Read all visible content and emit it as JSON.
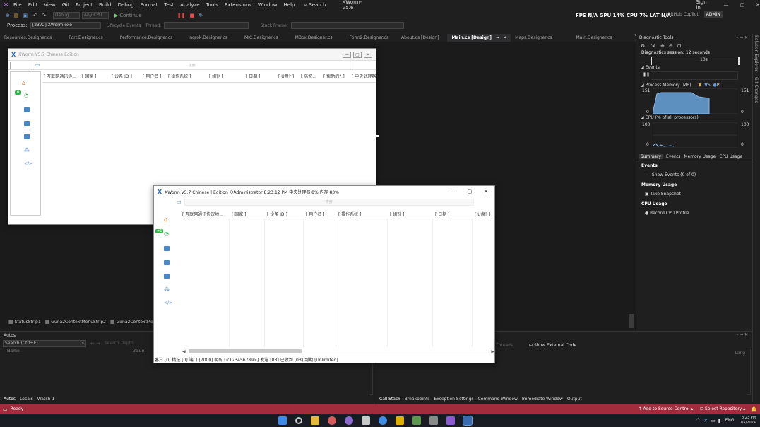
{
  "menubar": {
    "items": [
      "File",
      "Edit",
      "View",
      "Git",
      "Project",
      "Build",
      "Debug",
      "Format",
      "Test",
      "Analyze",
      "Tools",
      "Extensions",
      "Window",
      "Help"
    ],
    "search": "Search",
    "title": "XWorm-V5.6",
    "sign_in": "Sign in",
    "github": "GitHub Copilot",
    "admin": "ADMIN"
  },
  "toolbar": {
    "debug": "Debug",
    "cpu": "Any CPU",
    "continue": "Continue",
    "metrics": "FPS N/A GPU 14% CPU 7% LAT N/A"
  },
  "procbar": {
    "label": "Process:",
    "process": "[2372] XWorm.exe",
    "lifecycle": "Lifecycle Events",
    "thread": "Thread:",
    "stack": "Stack Frame:"
  },
  "tabs": [
    "Resources.Designer.cs",
    "Port.Designer.cs",
    "Performance.Designer.cs",
    "ngrok.Designer.cs",
    "MIC.Designer.cs",
    "MBox.Designer.cs",
    "Form2.Designer.cs",
    "About.cs [Design]",
    "Main.cs [Design]",
    "Maps.Designer.cs",
    "Main.Designer.cs"
  ],
  "designer": {
    "title": "XWorm V5.7 Chinese Edition",
    "search": "搜索",
    "columns": [
      "[ 互联网通讯协...",
      "[ 国家 ]",
      "[ 设备 ID ]",
      "[ 用户名 ]",
      "[ 操作系统 ]",
      "[ 组别 ]",
      "[ 日期 ]",
      "[ U盘? ]",
      "[ 防警...",
      "[ 帮助的? ]",
      "[ 中央处理器"
    ],
    "badge": "0",
    "components": [
      "StatusStrip1",
      "Guna2ContextMenuStrip2",
      "Guna2ContextMenuStr"
    ]
  },
  "app": {
    "title": "XWorm V5.7 Chinese | Edition @Administrator   8:23:12 PM   中央处理器 8%   内存 83%",
    "search": "搜索",
    "columns": [
      "[ 互联网通讯协议地...",
      "[ 国家 ]",
      "[ 设备 ID ]",
      "[ 用户名 ]",
      "[ 操作系统 ]",
      "[ 组别 ]",
      "[ 日期 ]",
      "[ U盘? ]"
    ],
    "badge": "+1",
    "status": "客户 [0]   精选 [0]   端口 [7000]   明码 [<123456789>]   发送 [0B]   已收到 [0B]   到期 [Unlimited]"
  },
  "diag": {
    "title": "Diagnostic Tools",
    "session": "Diagnostics session: 12 seconds",
    "time": "10s",
    "events": "Events",
    "memory": "Process Memory (MB)",
    "mem_legend": "S",
    "mem_legend2": "P..",
    "mem_max": "151",
    "mem_min": "0",
    "cpu": "CPU (% of all processors)",
    "cpu_max": "100",
    "cpu_min": "0",
    "tabs": [
      "Summary",
      "Events",
      "Memory Usage",
      "CPU Usage"
    ],
    "sec_events": "Events",
    "show_events": "Show Events (0 of 0)",
    "sec_mem": "Memory Usage",
    "snapshot": "Take Snapshot",
    "sec_cpu": "CPU Usage",
    "record": "Record CPU Profile"
  },
  "rstrip": {
    "a": "Solution Explorer",
    "b": "Git Changes"
  },
  "autos": {
    "title": "Autos",
    "search": "Search (Ctrl+E)",
    "depth": "Search Depth:",
    "name": "Name",
    "value": "Value",
    "tabs": [
      "Autos",
      "Locals",
      "Watch 1"
    ]
  },
  "callstack": {
    "threads": "all Threads",
    "external": "Show External Code",
    "lang": "Lang",
    "tabs": [
      "Call Stack",
      "Breakpoints",
      "Exception Settings",
      "Command Window",
      "Immediate Window",
      "Output"
    ]
  },
  "status": {
    "ready": "Ready",
    "source": "Add to Source Control",
    "repo": "Select Repository"
  },
  "taskbar": {
    "lang": "ENG",
    "time": "8:23 PM",
    "date": "7/5/2024"
  }
}
